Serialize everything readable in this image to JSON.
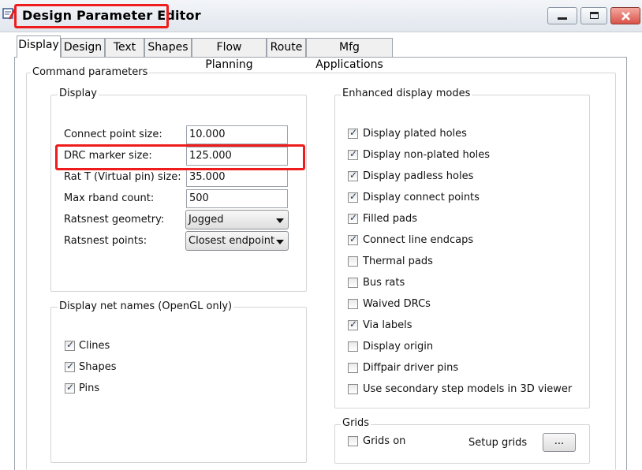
{
  "window": {
    "title": "Design Parameter Editor",
    "controls": [
      "minimize",
      "maximize",
      "close"
    ]
  },
  "tabs": [
    "Display",
    "Design",
    "Text",
    "Shapes",
    "Flow Planning",
    "Route",
    "Mfg Applications"
  ],
  "active_tab": "Display",
  "command_parameters": {
    "title": "Command parameters",
    "display": {
      "title": "Display",
      "fields": [
        {
          "label": "Connect point size:",
          "value": "10.000"
        },
        {
          "label": "DRC marker size:",
          "value": "125.000"
        },
        {
          "label": "Rat T (Virtual pin) size:",
          "value": "35.000"
        },
        {
          "label": "Max rband count:",
          "value": "500"
        }
      ],
      "selects": [
        {
          "label": "Ratsnest geometry:",
          "value": "Jogged"
        },
        {
          "label": "Ratsnest points:",
          "value": "Closest endpoint"
        }
      ]
    },
    "net_names": {
      "title": "Display net names (OpenGL only)",
      "items": [
        {
          "label": "Clines",
          "checked": true
        },
        {
          "label": "Shapes",
          "checked": true
        },
        {
          "label": "Pins",
          "checked": true
        }
      ]
    },
    "enhanced": {
      "title": "Enhanced display modes",
      "items": [
        {
          "label": "Display plated holes",
          "checked": true
        },
        {
          "label": "Display non-plated holes",
          "checked": true
        },
        {
          "label": "Display padless holes",
          "checked": true
        },
        {
          "label": "Display connect points",
          "checked": true
        },
        {
          "label": "Filled pads",
          "checked": true
        },
        {
          "label": "Connect line endcaps",
          "checked": true
        },
        {
          "label": "Thermal pads",
          "checked": false
        },
        {
          "label": "Bus rats",
          "checked": false
        },
        {
          "label": "Waived DRCs",
          "checked": false
        },
        {
          "label": "Via labels",
          "checked": true
        },
        {
          "label": "Display origin",
          "checked": false
        },
        {
          "label": "Diffpair driver pins",
          "checked": false
        },
        {
          "label": "Use secondary step models in 3D viewer",
          "checked": false
        }
      ]
    },
    "grids": {
      "title": "Grids",
      "grids_on_label": "Grids on",
      "grids_on_checked": false,
      "setup_label": "Setup grids",
      "setup_button": "..."
    }
  },
  "colors": {
    "highlight": "#ee1c1c",
    "check_mark": "#2a3c55"
  }
}
